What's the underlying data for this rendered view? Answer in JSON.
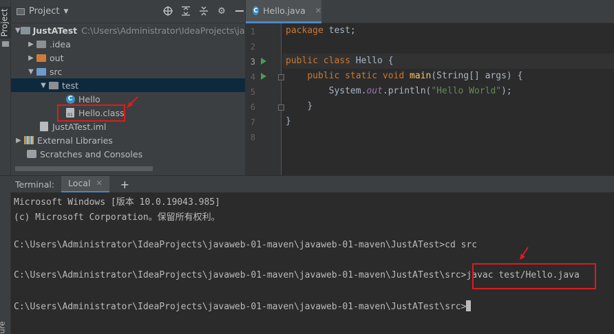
{
  "side_stripe": {
    "project_label": "Project",
    "bottom_label": "ure"
  },
  "project_panel": {
    "title": "Project",
    "tools": [
      "locate-icon",
      "expand-all-icon",
      "collapse-all-icon",
      "gear-icon",
      "minimize-icon"
    ],
    "tree": {
      "root_name": "JustATest",
      "root_path": "C:\\Users\\Administrator\\IdeaProjects\\jav",
      "idea": ".idea",
      "out": "out",
      "src": "src",
      "test": "test",
      "hello": "Hello",
      "hello_class": "Hello.class",
      "iml": "JustATest.iml",
      "ext_libs": "External Libraries",
      "scratches": "Scratches and Consoles"
    }
  },
  "editor": {
    "tab_label": "Hello.java",
    "line_numbers": [
      "1",
      "2",
      "3",
      "4",
      "5",
      "6",
      "7",
      "8"
    ],
    "code": {
      "l1_kw": "package",
      "l1_rest": " test;",
      "l3_kw": "public class",
      "l3_rest": " Hello {",
      "l4_kw": "public static void",
      "l4_fn": "main",
      "l4_rest": "(String[] args) {",
      "l5_a": "System.",
      "l5_field": "out",
      "l5_b": ".println(",
      "l5_str": "\"Hello World\"",
      "l5_c": ");",
      "l6": "}",
      "l7": "}"
    }
  },
  "terminal": {
    "label": "Terminal:",
    "tab_label": "Local",
    "lines": [
      "Microsoft Windows [版本 10.0.19043.985]",
      "(c) Microsoft Corporation。保留所有权利。",
      "C:\\Users\\Administrator\\IdeaProjects\\javaweb-01-maven\\javaweb-01-maven\\JustATest>cd src",
      "C:\\Users\\Administrator\\IdeaProjects\\javaweb-01-maven\\javaweb-01-maven\\JustATest\\src>",
      "javac test/Hello.java",
      "C:\\Users\\Administrator\\IdeaProjects\\javaweb-01-maven\\javaweb-01-maven\\JustATest\\src>"
    ]
  },
  "colors": {
    "highlight_red": "#e01b1b",
    "selection_blue": "#0d293e",
    "accent_blue": "#4a88c7",
    "keyword_orange": "#cc7832",
    "string_green": "#6a8759"
  }
}
